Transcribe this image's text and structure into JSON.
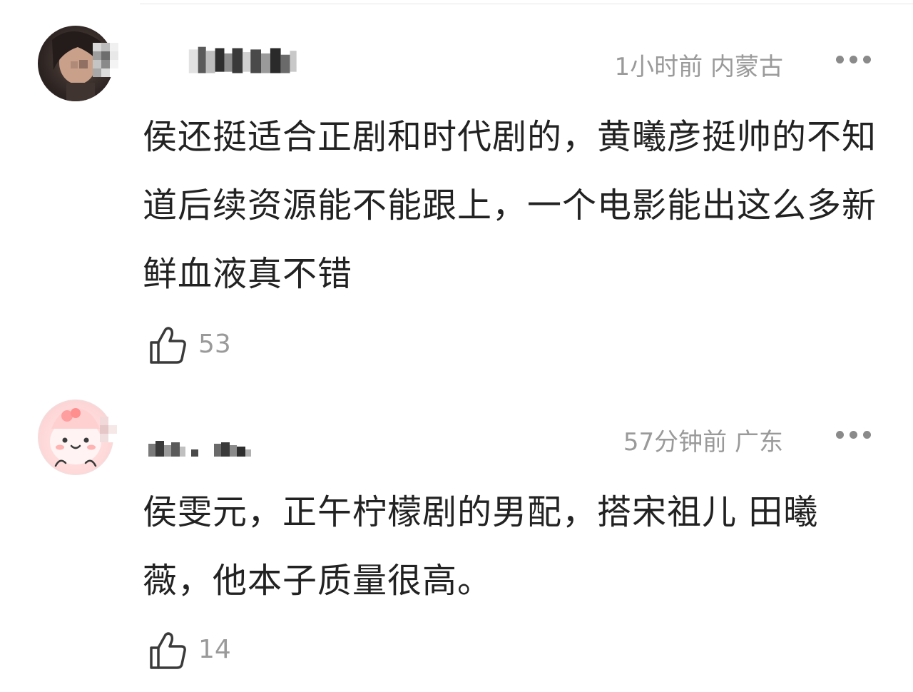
{
  "comments": [
    {
      "time": "1小时前",
      "location": "内蒙古",
      "text": "侯还挺适合正剧和时代剧的，黄曦彦挺帅的不知道后续资源能不能跟上，一个电影能出这么多新鲜血液真不错",
      "likes": "53"
    },
    {
      "time": "57分钟前",
      "location": "广东",
      "text": "侯雯元，正午柠檬剧的男配，搭宋祖儿 田曦薇，他本子质量很高。",
      "likes": "14"
    }
  ],
  "icons": {
    "like": "thumbs-up-icon",
    "more": "more-dots-icon"
  }
}
